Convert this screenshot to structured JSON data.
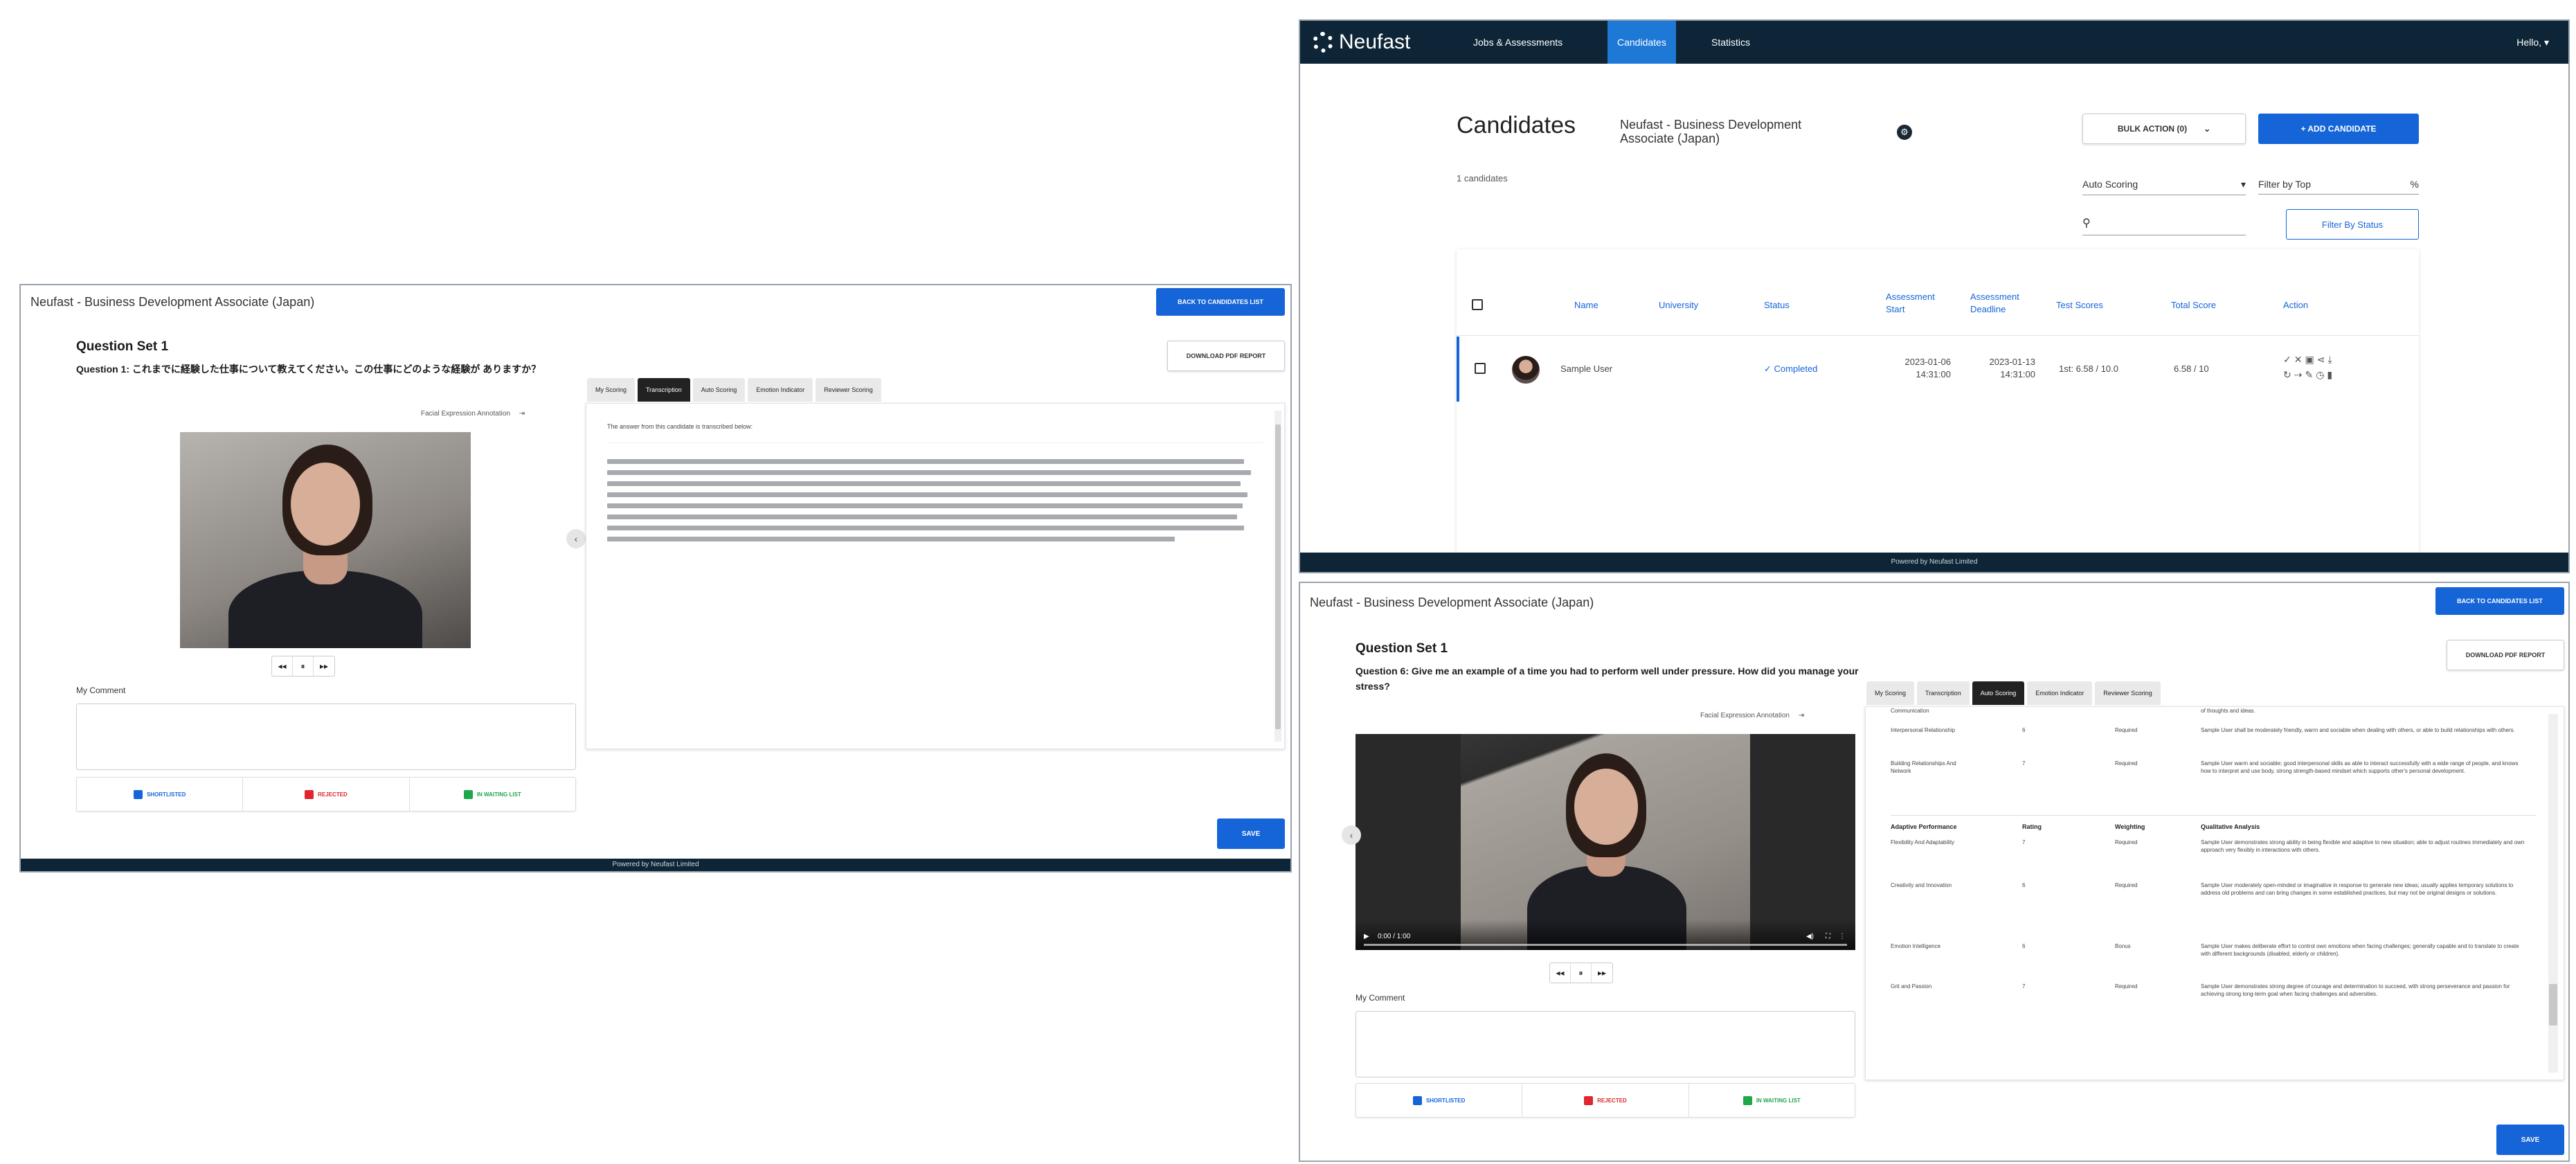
{
  "left_shot": {
    "header_title": "Neufast - Business Development Associate (Japan)",
    "back_button": "BACK TO CANDIDATES LIST",
    "download_button": "DOWNLOAD PDF REPORT",
    "question_set": "Question Set 1",
    "question_text": "Question 1: これまでに経験した仕事について教えてください。この仕事にどのような経験が ありますか？",
    "facial_expression_annotation": "Facial Expression Annotation",
    "tabs": [
      "My Scoring",
      "Transcription",
      "Auto Scoring",
      "Emotion Indicator",
      "Reviewer Scoring"
    ],
    "active_tab": "Transcription",
    "transcription_intro": "The answer from this candidate is transcribed below:",
    "my_comment_label": "My Comment",
    "rating_buttons": [
      "SHORTLISTED",
      "REJECTED",
      "IN WAITING LIST"
    ],
    "save_button": "SAVE",
    "footer": "Powered by Neufast Limited"
  },
  "candidates_shot": {
    "logo": "Neufast",
    "nav": [
      "Jobs & Assessments",
      "Candidates",
      "Statistics"
    ],
    "active_nav": "Candidates",
    "user_menu": "Hello, ▾",
    "page_title": "Candidates",
    "job_title": "Neufast - Business Development Associate (Japan)",
    "bulk_action": "BULK ACTION (0)",
    "add_candidate": "+ ADD CANDIDATE",
    "candidate_count": "1 candidates",
    "auto_scoring_select": "Auto Scoring",
    "filter_by_top": "Filter by Top",
    "filter_by_top_value": "%",
    "filter_by_status": "Filter By Status",
    "table_headers": [
      "Name",
      "University",
      "Status",
      "Assessment Start",
      "Assessment Deadline",
      "Test Scores",
      "Total Score",
      "Action"
    ],
    "row": {
      "name": "Sample User",
      "university": "",
      "status": "Completed",
      "start": "2023-01-06 14:31:00",
      "deadline": "2023-01-13 14:31:00",
      "test_scores": "1st: 6.58 / 10.0",
      "total_score": "6.58 / 10"
    },
    "footer": "Powered by Neufast Limited"
  },
  "right_shot": {
    "header_title": "Neufast - Business Development Associate (Japan)",
    "back_button": "BACK TO CANDIDATES LIST",
    "download_button": "DOWNLOAD PDF REPORT",
    "question_set": "Question Set 1",
    "question_text": "Question 6: Give me an example of a time you had to perform well under pressure. How did you manage your stress?",
    "facial_expression_annotation": "Facial Expression Annotation",
    "tabs": [
      "My Scoring",
      "Transcription",
      "Auto Scoring",
      "Emotion Indicator",
      "Reviewer Scoring"
    ],
    "active_tab": "Auto Scoring",
    "video_time": "0:00 / 1:00",
    "scoring_top_rows": [
      {
        "competency": "Communication",
        "rating": "",
        "weighting": "",
        "analysis": "of thoughts and ideas."
      },
      {
        "competency": "Interpersonal Relationship",
        "rating": "6",
        "weighting": "Required",
        "analysis": "Sample User shall be moderately friendly, warm and sociable when dealing with others, or able to build relationships with others."
      },
      {
        "competency": "Building Relationships And Network",
        "rating": "7",
        "weighting": "Required",
        "analysis": "Sample User warm and sociable; good interpersonal skills as able to interact successfully with a wide range of people, and knows how to interpret and use body, strong strength-based mindset which supports other's personal development."
      }
    ],
    "scoring_headers": [
      "Adaptive Performance",
      "Rating",
      "Weighting",
      "Qualitative Analysis"
    ],
    "scoring_rows": [
      {
        "competency": "Flexibility And Adaptability",
        "rating": "7",
        "weighting": "Required",
        "analysis": "Sample User demonstrates strong ability in being flexible and adaptive to new situation; able to adjust routines immediately and own approach very flexibly in interactions with others."
      },
      {
        "competency": "Creativity and Innovation",
        "rating": "6",
        "weighting": "Required",
        "analysis": "Sample User moderately open-minded or imaginative in response to generate new ideas; usually applies temporary solutions to address old problems and can bring changes in some established practices, but may not be original designs or solutions."
      },
      {
        "competency": "Emotion Intelligence",
        "rating": "6",
        "weighting": "Bonus",
        "analysis": "Sample User makes deliberate effort to control own emotions when facing challenges; generally capable and to translate to create with different backgrounds (disabled, elderly or children)."
      },
      {
        "competency": "Grit and Passion",
        "rating": "7",
        "weighting": "Required",
        "analysis": "Sample User demonstrates strong degree of courage and determination to succeed, with strong perseverance and passion for achieving strong long-term goal when facing challenges and adversities."
      }
    ],
    "my_comment_label": "My Comment",
    "rating_buttons": [
      "SHORTLISTED",
      "REJECTED",
      "IN WAITING LIST"
    ],
    "save_button": "SAVE"
  },
  "colors": {
    "brand_dark": "#0d2536",
    "primary_blue": "#1565d8",
    "nav_active": "#1d78d6",
    "shortlisted": "#1565d8",
    "rejected": "#e0262e",
    "waiting": "#1fa84a",
    "completed": "#1565d8"
  }
}
